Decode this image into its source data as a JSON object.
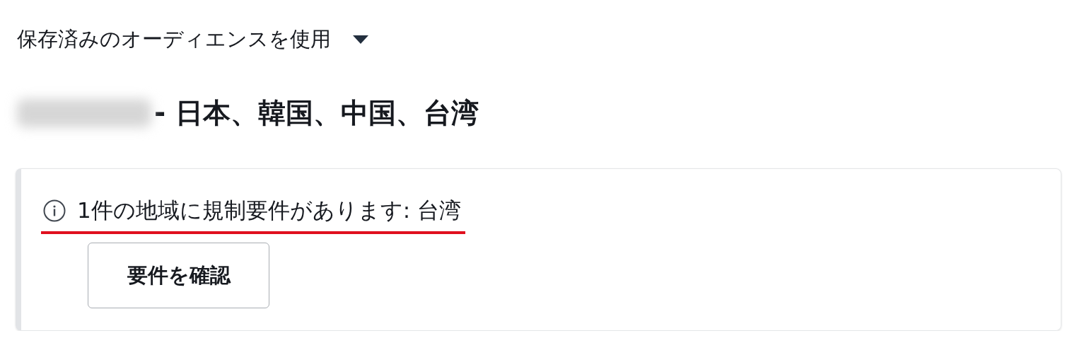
{
  "audience_selector": {
    "label": "保存済みのオーディエンスを使用",
    "expanded": false
  },
  "audience": {
    "name_blurred": true,
    "regions": "- 日本、韓国、中国、台湾"
  },
  "notice": {
    "message": "1件の地域に規制要件があります: 台湾",
    "underlined": true,
    "button": "要件を確認"
  }
}
